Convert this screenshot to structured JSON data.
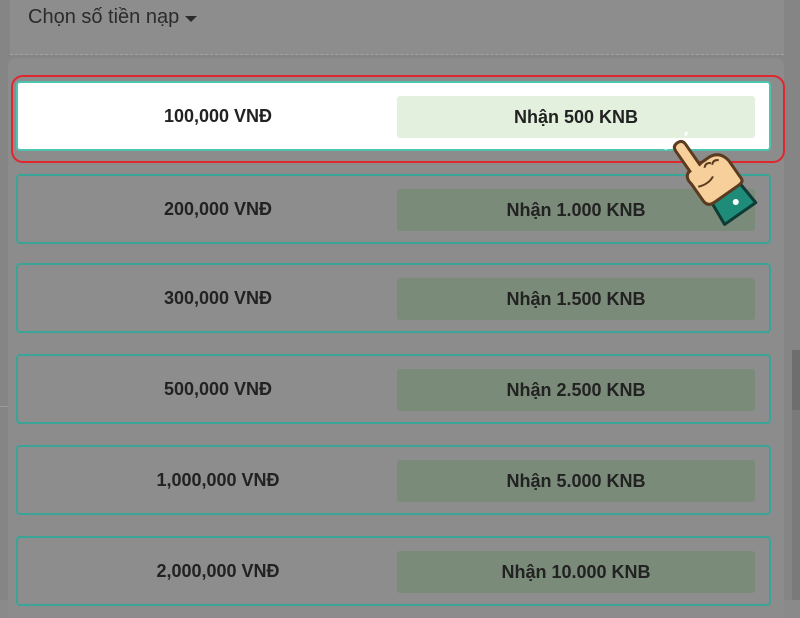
{
  "header": {
    "label": "Chọn số tiền nạp"
  },
  "options": [
    {
      "amount": "100,000 VNĐ",
      "reward": "Nhận 500 KNB",
      "selected": true
    },
    {
      "amount": "200,000 VNĐ",
      "reward": "Nhận 1.000 KNB",
      "selected": false
    },
    {
      "amount": "300,000 VNĐ",
      "reward": "Nhận 1.500 KNB",
      "selected": false
    },
    {
      "amount": "500,000 VNĐ",
      "reward": "Nhận 2.500 KNB",
      "selected": false
    },
    {
      "amount": "1,000,000 VNĐ",
      "reward": "Nhận 5.000 KNB",
      "selected": false
    },
    {
      "amount": "2,000,000 VNĐ",
      "reward": "Nhận 10.000 KNB",
      "selected": false
    }
  ],
  "icons": {
    "dropdown": "caret-down-icon",
    "pointer": "pointing-hand-icon"
  },
  "colors": {
    "row_border": "#3aa596",
    "selected_reward_bg": "#e2f0dd",
    "highlight": "#e0262e",
    "overlay": "#858585"
  }
}
